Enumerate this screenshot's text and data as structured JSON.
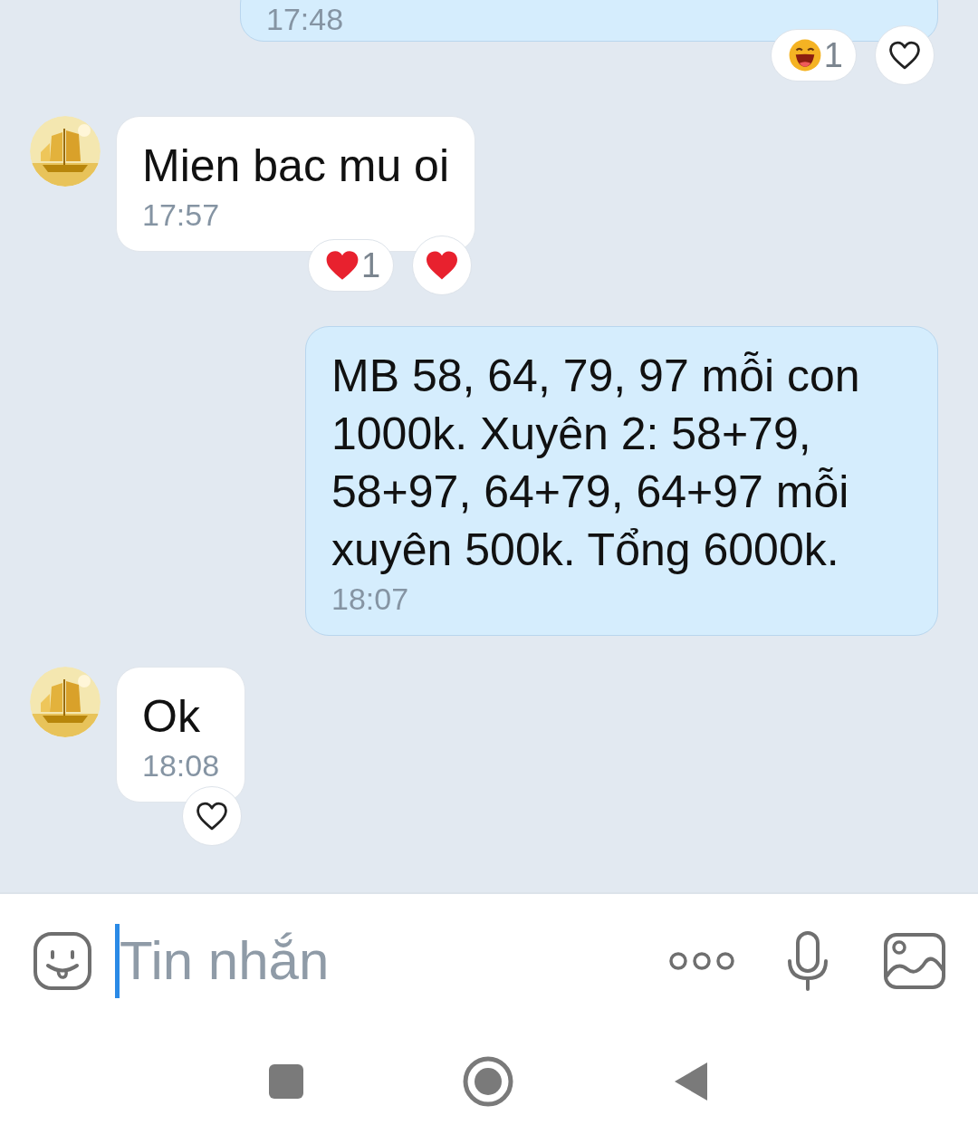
{
  "messages": [
    {
      "kind": "out",
      "time": "17:48",
      "reactions": [
        {
          "kind": "laugh",
          "count": "1"
        }
      ],
      "react_button": {
        "reacted": false
      }
    },
    {
      "kind": "in",
      "text": "Mien bac mu oi",
      "time": "17:57",
      "reactions": [
        {
          "kind": "heart",
          "count": "1"
        }
      ],
      "react_button": {
        "reacted": true
      }
    },
    {
      "kind": "out",
      "text": "MB 58, 64, 79, 97 mỗi con 1000k. Xuyên 2: 58+79, 58+97, 64+79, 64+97 mỗi xuyên 500k. Tổng 6000k.",
      "time": "18:07"
    },
    {
      "kind": "in",
      "text": "Ok",
      "time": "18:08",
      "react_button": {
        "reacted": false
      }
    }
  ],
  "composer": {
    "placeholder": "Tin nhắn"
  }
}
